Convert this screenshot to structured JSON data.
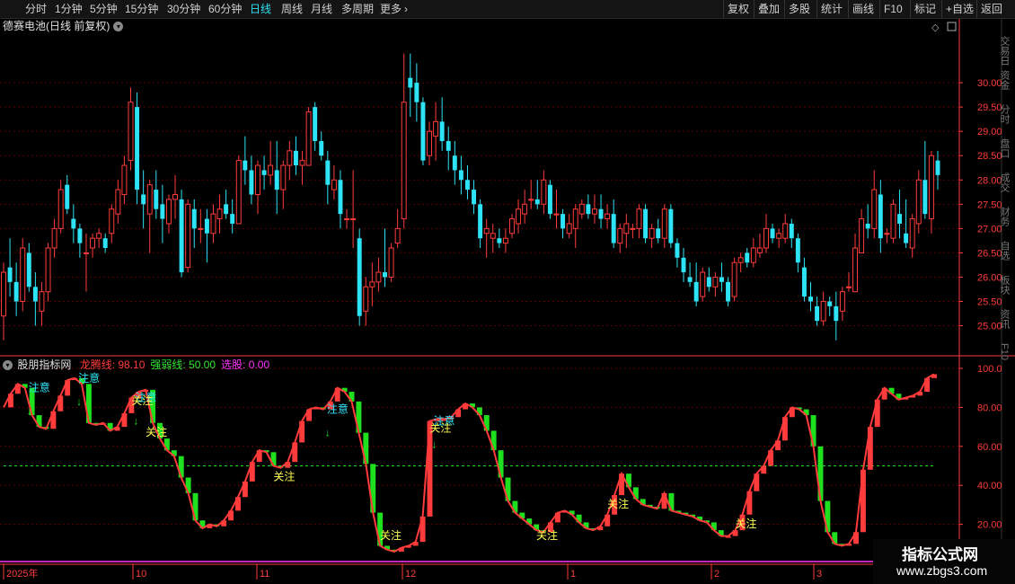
{
  "toolbar": {
    "periods": [
      "分时",
      "1分钟",
      "5分钟",
      "15分钟",
      "30分钟",
      "60分钟",
      "日线",
      "周线",
      "月线",
      "多周期",
      "更多"
    ],
    "more_icon": "chevron-right-icon",
    "active_period": "日线",
    "right_buttons": [
      "复权",
      "叠加",
      "多股",
      "统计",
      "画线",
      "F10",
      "标记",
      "+自选",
      "返回"
    ]
  },
  "stock": {
    "title": "德赛电池(日线 前复权)",
    "dropdown_icon": "chevron-down-icon"
  },
  "indicator": {
    "name": "股朋指标网",
    "lines": [
      {
        "label": "龙腾线:",
        "value": "98.10",
        "color": "#ff3b3b"
      },
      {
        "label": "强弱线:",
        "value": "50.00",
        "color": "#33e633"
      },
      {
        "label": "选股:",
        "value": "0.00",
        "color": "#ff33ff"
      }
    ]
  },
  "price_axis": [
    "30.00",
    "29.50",
    "29.00",
    "28.50",
    "28.00",
    "27.50",
    "27.00",
    "26.50",
    "26.00",
    "25.50",
    "25.00"
  ],
  "indicator_axis": [
    "100.0",
    "80.00",
    "60.00",
    "40.00",
    "20.00"
  ],
  "date_axis": [
    "2025年",
    "10",
    "11",
    "12",
    "1",
    "2",
    "3"
  ],
  "annotations": {
    "attention": "注意",
    "focus": "关注"
  },
  "right_panel_labels": [
    "交易日",
    "资金",
    "分时",
    "盘口",
    "成交",
    "财务",
    "自选",
    "板块",
    "资讯",
    "F10"
  ],
  "watermark": {
    "title": "指标公式网",
    "url": "www.zbgs3.com"
  },
  "colors": {
    "up": "#ff3b3b",
    "down": "#2de3f6",
    "green": "#1fe01f",
    "magenta": "#ff33ff",
    "grid": "#5a0000",
    "axis": "#ff3b3b"
  },
  "chart_data": {
    "type": "candlestick",
    "series": [
      {
        "name": "德赛电池",
        "unit": "price",
        "ohlc": [
          [
            25.2,
            26.3,
            24.7,
            26.1
          ],
          [
            26.2,
            26.8,
            25.6,
            25.9
          ],
          [
            25.9,
            26.3,
            25.2,
            25.5
          ],
          [
            25.5,
            26.8,
            25.3,
            26.6
          ],
          [
            26.5,
            26.7,
            25.7,
            25.8
          ],
          [
            25.8,
            26.1,
            25.0,
            25.5
          ],
          [
            25.3,
            25.9,
            25.0,
            25.7
          ],
          [
            25.7,
            26.7,
            25.5,
            26.6
          ],
          [
            26.6,
            27.2,
            26.4,
            27.0
          ],
          [
            27.0,
            28.0,
            26.9,
            27.8
          ],
          [
            27.9,
            28.1,
            27.3,
            27.4
          ],
          [
            27.2,
            27.5,
            26.7,
            27.0
          ],
          [
            27.0,
            27.1,
            26.4,
            26.7
          ],
          [
            26.5,
            26.9,
            25.7,
            26.5
          ],
          [
            26.6,
            26.9,
            26.4,
            26.8
          ],
          [
            26.8,
            27.0,
            26.6,
            26.9
          ],
          [
            26.8,
            26.9,
            26.5,
            26.6
          ],
          [
            26.9,
            27.5,
            26.7,
            27.4
          ],
          [
            27.3,
            28.0,
            27.1,
            27.8
          ],
          [
            27.7,
            28.5,
            27.5,
            28.3
          ],
          [
            28.4,
            29.9,
            28.2,
            29.6
          ],
          [
            29.5,
            29.8,
            27.5,
            27.8
          ],
          [
            27.7,
            28.2,
            27.0,
            27.5
          ],
          [
            27.3,
            28.0,
            26.5,
            27.9
          ],
          [
            27.8,
            28.2,
            27.2,
            27.4
          ],
          [
            27.5,
            27.9,
            26.7,
            27.2
          ],
          [
            27.1,
            27.7,
            26.9,
            27.6
          ],
          [
            27.6,
            28.1,
            27.2,
            27.7
          ],
          [
            27.6,
            27.8,
            26.0,
            26.1
          ],
          [
            26.2,
            27.6,
            26.1,
            27.5
          ],
          [
            27.4,
            27.6,
            26.6,
            27.0
          ],
          [
            27.0,
            27.4,
            26.7,
            27.0
          ],
          [
            27.2,
            27.4,
            26.3,
            26.9
          ],
          [
            26.9,
            27.5,
            26.7,
            27.3
          ],
          [
            27.2,
            27.7,
            26.9,
            27.4
          ],
          [
            27.5,
            27.8,
            27.2,
            27.3
          ],
          [
            27.3,
            27.6,
            26.9,
            27.1
          ],
          [
            27.1,
            28.5,
            27.1,
            28.4
          ],
          [
            28.4,
            28.9,
            27.9,
            28.2
          ],
          [
            28.2,
            28.5,
            27.5,
            27.7
          ],
          [
            27.7,
            28.4,
            27.3,
            28.3
          ],
          [
            28.2,
            28.5,
            27.8,
            28.1
          ],
          [
            28.1,
            28.8,
            27.9,
            28.3
          ],
          [
            28.2,
            28.8,
            27.3,
            27.8
          ],
          [
            27.8,
            28.4,
            27.4,
            28.3
          ],
          [
            28.3,
            28.8,
            28.0,
            28.6
          ],
          [
            28.6,
            28.9,
            28.1,
            28.3
          ],
          [
            28.3,
            28.6,
            27.9,
            28.4
          ],
          [
            28.3,
            29.5,
            28.3,
            29.4
          ],
          [
            29.5,
            29.6,
            28.6,
            28.8
          ],
          [
            28.8,
            29.0,
            28.4,
            28.5
          ],
          [
            28.4,
            28.6,
            27.5,
            27.9
          ],
          [
            27.8,
            28.3,
            27.6,
            28.0
          ],
          [
            28.0,
            28.2,
            27.0,
            27.3
          ],
          [
            27.2,
            27.4,
            27.0,
            27.2
          ],
          [
            27.2,
            28.2,
            26.6,
            27.2
          ],
          [
            26.8,
            27.0,
            25.0,
            25.2
          ],
          [
            25.3,
            26.0,
            25.0,
            25.8
          ],
          [
            25.8,
            26.3,
            25.4,
            25.9
          ],
          [
            25.9,
            26.4,
            25.7,
            26.1
          ],
          [
            26.1,
            27.0,
            25.8,
            26.0
          ],
          [
            26.0,
            26.7,
            25.9,
            26.6
          ],
          [
            26.7,
            27.4,
            26.6,
            27.0
          ],
          [
            27.2,
            30.6,
            27.0,
            29.6
          ],
          [
            30.1,
            30.6,
            29.3,
            29.9
          ],
          [
            30.0,
            30.4,
            29.2,
            29.6
          ],
          [
            29.6,
            29.7,
            28.3,
            28.4
          ],
          [
            28.5,
            29.2,
            28.3,
            29.0
          ],
          [
            28.9,
            29.6,
            28.4,
            29.2
          ],
          [
            29.2,
            29.7,
            28.6,
            28.8
          ],
          [
            28.8,
            29.1,
            28.2,
            28.6
          ],
          [
            28.5,
            28.8,
            27.9,
            28.2
          ],
          [
            28.2,
            28.5,
            27.7,
            28.0
          ],
          [
            28.0,
            28.3,
            27.6,
            27.8
          ],
          [
            27.8,
            28.0,
            27.3,
            27.5
          ],
          [
            27.5,
            27.6,
            26.6,
            26.8
          ],
          [
            26.9,
            27.2,
            26.4,
            27.0
          ],
          [
            26.8,
            27.1,
            26.5,
            26.9
          ],
          [
            26.8,
            27.0,
            26.6,
            26.7
          ],
          [
            26.7,
            27.0,
            26.5,
            26.8
          ],
          [
            26.9,
            27.3,
            26.8,
            27.2
          ],
          [
            27.1,
            27.6,
            26.9,
            27.4
          ],
          [
            27.3,
            27.8,
            27.1,
            27.5
          ],
          [
            27.6,
            28.0,
            27.4,
            27.6
          ],
          [
            27.6,
            28.0,
            27.4,
            27.5
          ],
          [
            27.5,
            28.2,
            27.3,
            28.0
          ],
          [
            27.9,
            28.0,
            27.2,
            27.3
          ],
          [
            27.3,
            27.8,
            27.0,
            27.3
          ],
          [
            27.3,
            27.4,
            26.8,
            27.0
          ],
          [
            26.9,
            27.3,
            26.8,
            27.1
          ],
          [
            27.0,
            27.5,
            26.6,
            27.4
          ],
          [
            27.3,
            27.6,
            27.2,
            27.5
          ],
          [
            27.5,
            27.7,
            27.2,
            27.3
          ],
          [
            27.3,
            27.7,
            27.1,
            27.4
          ],
          [
            27.4,
            27.7,
            27.0,
            27.2
          ],
          [
            27.2,
            27.5,
            27.0,
            27.3
          ],
          [
            27.3,
            27.6,
            26.6,
            26.7
          ],
          [
            26.7,
            27.1,
            26.5,
            27.0
          ],
          [
            26.9,
            27.3,
            26.6,
            27.1
          ],
          [
            27.0,
            27.1,
            26.8,
            27.0
          ],
          [
            27.0,
            27.5,
            26.8,
            27.4
          ],
          [
            27.4,
            27.5,
            26.7,
            26.8
          ],
          [
            26.8,
            27.1,
            26.6,
            27.0
          ],
          [
            27.0,
            27.2,
            26.7,
            26.8
          ],
          [
            26.8,
            27.5,
            26.6,
            27.4
          ],
          [
            27.4,
            27.5,
            26.6,
            26.7
          ],
          [
            26.7,
            26.8,
            26.2,
            26.4
          ],
          [
            26.4,
            26.6,
            25.9,
            26.1
          ],
          [
            26.0,
            26.3,
            25.8,
            25.9
          ],
          [
            25.9,
            26.3,
            25.4,
            25.5
          ],
          [
            25.6,
            26.2,
            25.5,
            26.1
          ],
          [
            26.0,
            26.2,
            25.7,
            25.8
          ],
          [
            25.8,
            26.1,
            25.6,
            26.0
          ],
          [
            26.0,
            26.3,
            25.7,
            25.9
          ],
          [
            25.9,
            26.0,
            25.4,
            25.5
          ],
          [
            25.6,
            26.4,
            25.5,
            26.3
          ],
          [
            26.3,
            26.5,
            26.1,
            26.4
          ],
          [
            26.5,
            26.6,
            26.2,
            26.3
          ],
          [
            26.3,
            26.8,
            26.2,
            26.6
          ],
          [
            26.5,
            26.9,
            26.4,
            26.6
          ],
          [
            26.6,
            27.3,
            26.5,
            27.0
          ],
          [
            27.0,
            27.1,
            26.7,
            26.8
          ],
          [
            26.8,
            27.0,
            26.6,
            26.9
          ],
          [
            26.8,
            27.3,
            26.7,
            27.1
          ],
          [
            27.1,
            27.2,
            26.6,
            26.8
          ],
          [
            26.8,
            26.9,
            26.1,
            26.3
          ],
          [
            26.2,
            26.4,
            25.5,
            25.6
          ],
          [
            25.6,
            25.9,
            25.3,
            25.5
          ],
          [
            25.4,
            25.6,
            25.0,
            25.1
          ],
          [
            25.1,
            25.7,
            25.0,
            25.5
          ],
          [
            25.5,
            25.6,
            25.2,
            25.4
          ],
          [
            25.4,
            25.7,
            24.7,
            25.1
          ],
          [
            25.3,
            25.8,
            25.1,
            25.7
          ],
          [
            25.8,
            26.1,
            25.7,
            25.8
          ],
          [
            25.7,
            26.9,
            25.7,
            26.6
          ],
          [
            26.5,
            27.4,
            26.5,
            27.2
          ],
          [
            27.1,
            27.5,
            26.8,
            27.0
          ],
          [
            27.0,
            28.2,
            26.8,
            27.8
          ],
          [
            27.7,
            28.0,
            26.5,
            26.8
          ],
          [
            26.9,
            27.0,
            26.7,
            26.9
          ],
          [
            26.8,
            27.6,
            26.7,
            27.5
          ],
          [
            27.3,
            27.8,
            26.8,
            27.1
          ],
          [
            26.9,
            27.6,
            26.6,
            26.7
          ],
          [
            26.6,
            27.3,
            26.4,
            27.2
          ],
          [
            27.1,
            28.2,
            26.9,
            28.0
          ],
          [
            28.0,
            28.8,
            27.2,
            27.3
          ],
          [
            27.2,
            28.6,
            26.9,
            28.5
          ],
          [
            28.4,
            28.6,
            27.8,
            28.1
          ]
        ]
      }
    ],
    "price_range": [
      24.4,
      31.0
    ],
    "indicator_series": [
      {
        "name": "龙腾线",
        "values": [
          80,
          87,
          92,
          90,
          76,
          70,
          69,
          78,
          86,
          94,
          95,
          92,
          72,
          71,
          72,
          68,
          70,
          77,
          85,
          88,
          89,
          72,
          64,
          58,
          55,
          44,
          36,
          22,
          18,
          20,
          19,
          22,
          27,
          34,
          42,
          52,
          58,
          57,
          50,
          49,
          52,
          62,
          73,
          79,
          80,
          79,
          83,
          90,
          88,
          83,
          67,
          51,
          26,
          9,
          7,
          6,
          8,
          9,
          11,
          24,
          73,
          74,
          74,
          75,
          79,
          82,
          80,
          76,
          68,
          58,
          44,
          32,
          26,
          23,
          20,
          17,
          16,
          21,
          26,
          27,
          25,
          21,
          18,
          17,
          19,
          25,
          35,
          46,
          39,
          33,
          30,
          29,
          28,
          36,
          27,
          26,
          25,
          24,
          22,
          21,
          17,
          14,
          14,
          17,
          25,
          37,
          46,
          50,
          58,
          63,
          75,
          80,
          79,
          76,
          60,
          32,
          16,
          10,
          9,
          10,
          16,
          48,
          70,
          84,
          90,
          87,
          84,
          85,
          86,
          88,
          95,
          97
        ]
      },
      {
        "name": "强弱线",
        "values": [
          50
        ]
      },
      {
        "name": "选股",
        "values": [
          0
        ]
      }
    ],
    "indicator_range": [
      0,
      100
    ],
    "attention_markers": [
      "注意",
      "注意",
      "注意",
      "注意",
      "注意"
    ],
    "focus_markers": [
      "关注",
      "关注",
      "关注",
      "关注",
      "关注",
      "关注",
      "关注",
      "关注"
    ]
  }
}
